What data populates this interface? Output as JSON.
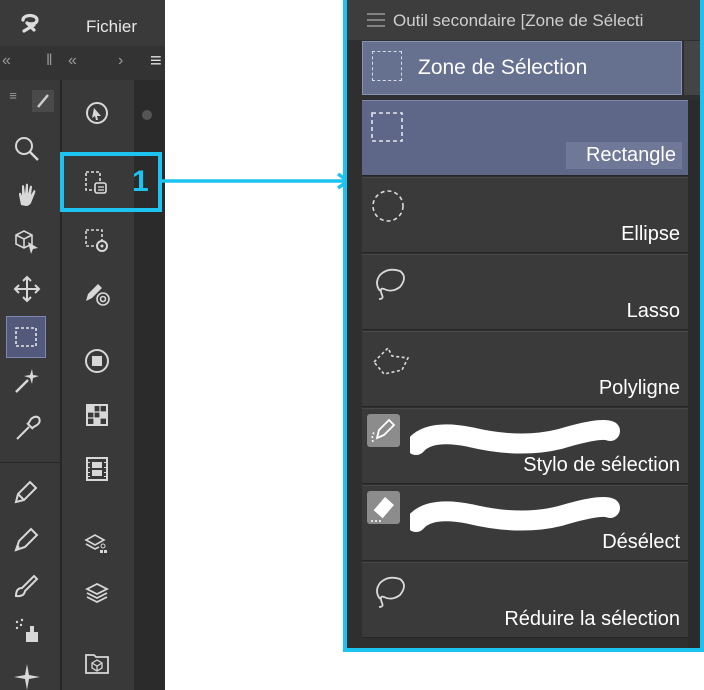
{
  "app": {
    "menu_fichier": "Fichier",
    "main_tools": [
      {
        "icon": "magnifier-icon"
      },
      {
        "icon": "hand-icon"
      },
      {
        "icon": "3d-object-icon"
      },
      {
        "icon": "move-icon"
      },
      {
        "icon": "selection-rectangle-icon",
        "active": true
      },
      {
        "icon": "magic-wand-icon"
      },
      {
        "icon": "eyedropper-icon"
      },
      {
        "icon": "pen-icon"
      },
      {
        "icon": "pencil-icon"
      },
      {
        "icon": "brush-icon"
      },
      {
        "icon": "airbrush-icon"
      },
      {
        "icon": "decoration-icon"
      }
    ],
    "sub_tools": [
      {
        "icon": "operation-icon"
      },
      {
        "icon": "selection-layer-icon",
        "highlighted": true
      },
      {
        "icon": "selection-settings-icon"
      },
      {
        "icon": "fill-pen-icon"
      },
      {
        "icon": "gradient-icon"
      },
      {
        "icon": "grid-icon"
      },
      {
        "icon": "film-icon"
      },
      {
        "icon": "layer-props-icon"
      },
      {
        "icon": "layers-icon"
      },
      {
        "icon": "material-icon"
      }
    ],
    "callout_number": "1",
    "accent_color": "#1cc3f0"
  },
  "panel": {
    "title": "Outil secondaire [Zone de Sélecti",
    "group_tab": "Zone de Sélection",
    "tools": [
      {
        "label": "Rectangle",
        "icon": "dashed-rectangle-icon",
        "selected": true
      },
      {
        "label": "Ellipse",
        "icon": "dashed-ellipse-icon"
      },
      {
        "label": "Lasso",
        "icon": "lasso-icon"
      },
      {
        "label": "Polyligne",
        "icon": "polyline-icon"
      },
      {
        "label": "Stylo de sélection",
        "icon": "selection-pen-icon"
      },
      {
        "label": "Désélect",
        "icon": "eraser-icon"
      },
      {
        "label": "Réduire la sélection",
        "icon": "lasso-icon"
      }
    ]
  }
}
